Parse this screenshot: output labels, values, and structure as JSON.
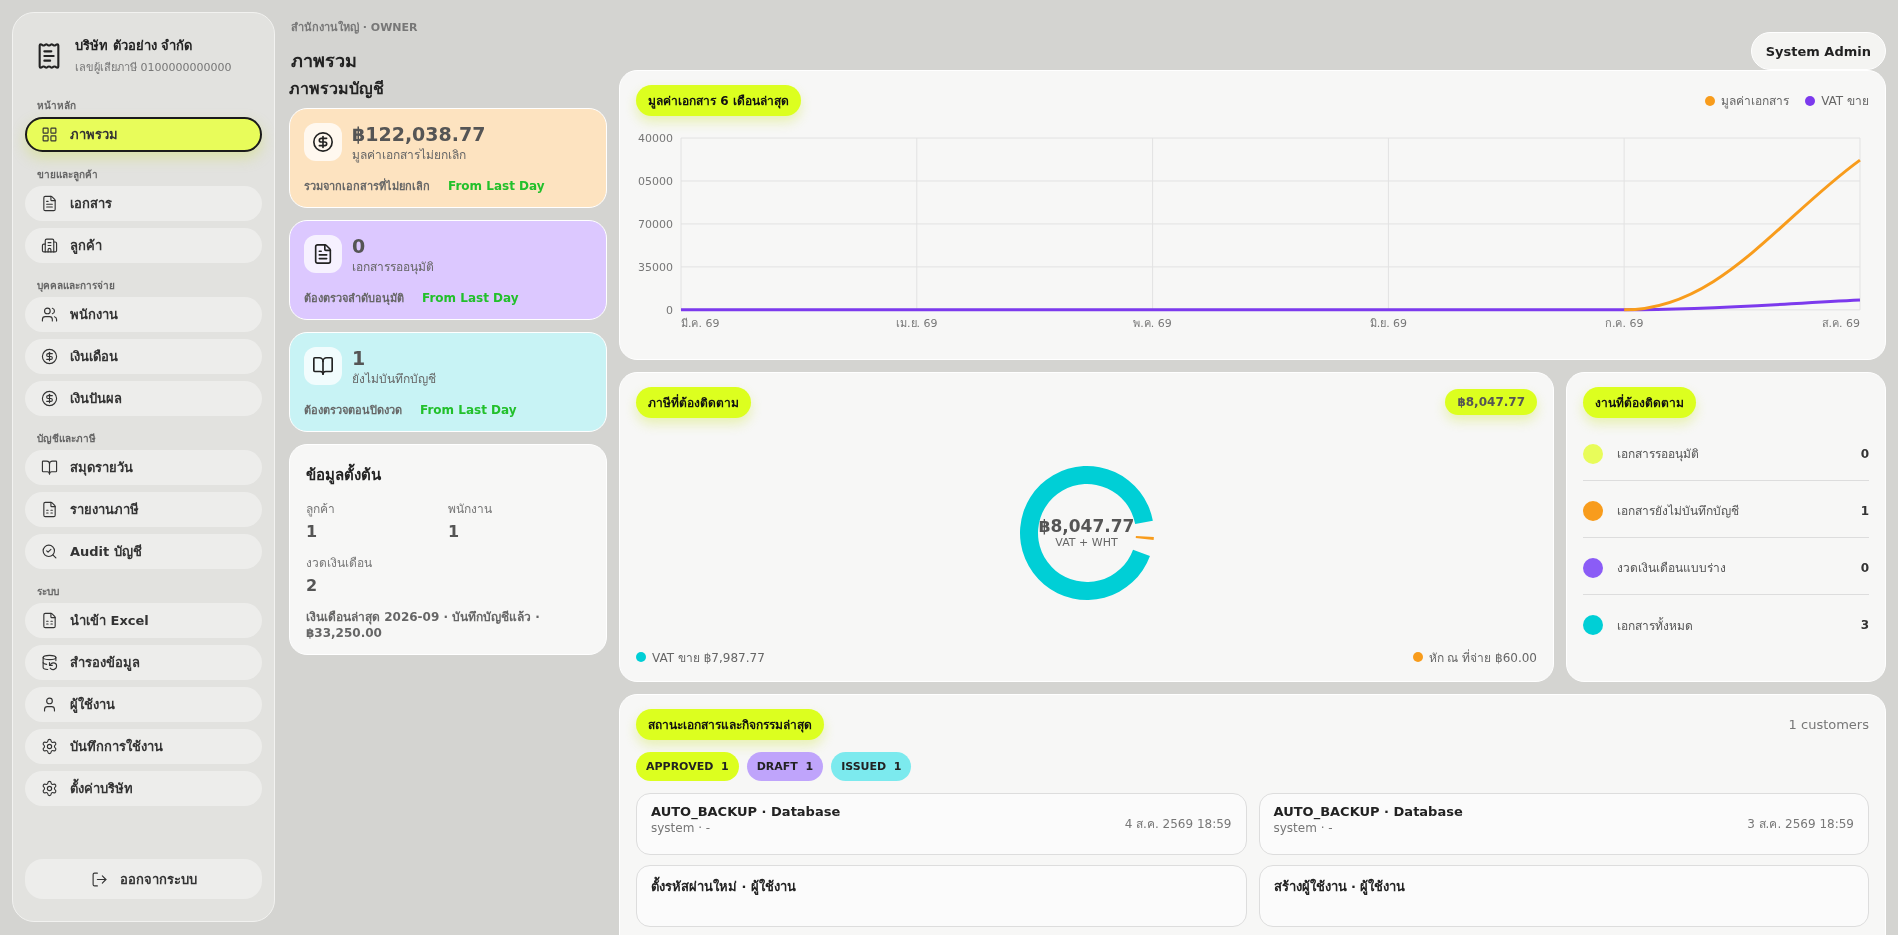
{
  "company": {
    "name": "บริษัท ตัวอย่าง จำกัด",
    "tax_id": "เลขผู้เสียภาษี 0100000000000"
  },
  "sidebar": {
    "sections": [
      {
        "title": "หน้าหลัก",
        "items": [
          {
            "label": "ภาพรวม",
            "selected": true
          }
        ]
      },
      {
        "title": "ขายและลูกค้า",
        "items": [
          {
            "label": "เอกสาร",
            "selected": false
          },
          {
            "label": "ลูกค้า",
            "selected": false
          }
        ]
      },
      {
        "title": "บุคคลและการจ่าย",
        "items": [
          {
            "label": "พนักงาน",
            "selected": false
          },
          {
            "label": "เงินเดือน",
            "selected": false
          },
          {
            "label": "เงินปันผล",
            "selected": false
          }
        ]
      },
      {
        "title": "บัญชีและภาษี",
        "items": [
          {
            "label": "สมุดรายวัน",
            "selected": false
          },
          {
            "label": "รายงานภาษี",
            "selected": false
          },
          {
            "label": "Audit บัญชี",
            "selected": false
          }
        ]
      },
      {
        "title": "ระบบ",
        "items": [
          {
            "label": "นำเข้า Excel",
            "selected": false
          },
          {
            "label": "สำรองข้อมูล",
            "selected": false
          },
          {
            "label": "ผู้ใช้งาน",
            "selected": false
          },
          {
            "label": "บันทึกการใช้งาน",
            "selected": false
          },
          {
            "label": "ตั้งค่าบริษัท",
            "selected": false
          }
        ]
      }
    ],
    "logout": "ออกจากระบบ"
  },
  "header": {
    "breadcrumb": "สำนักงานใหญ่ · OWNER",
    "title": "ภาพรวม",
    "user_button": "System Admin"
  },
  "overview": {
    "title": "ภาพรวมบัญชี",
    "cards": [
      {
        "value": "฿122,038.77",
        "label": "มูลค่าเอกสารไม่ยกเลิก",
        "note": "รวมจากเอกสารที่ไม่ยกเลิก",
        "trend": "From Last Day",
        "color": "#fde3c0"
      },
      {
        "value": "0",
        "label": "เอกสารรออนุมัติ",
        "note": "ต้องตรวจลำดับอนุมัติ",
        "trend": "From Last Day",
        "color": "#dcc8ff"
      },
      {
        "value": "1",
        "label": "ยังไม่บันทึกบัญชี",
        "note": "ต้องตรวจตอนปิดงวด",
        "trend": "From Last Day",
        "color": "#c8f3f5"
      }
    ]
  },
  "setup": {
    "title": "ข้อมูลตั้งต้น",
    "fields": [
      {
        "label": "ลูกค้า",
        "value": "1"
      },
      {
        "label": "พนักงาน",
        "value": "1"
      },
      {
        "label": "งวดเงินเดือน",
        "value": "2"
      }
    ],
    "note": "เงินเดือนล่าสุด 2026-09 · บันทึกบัญชีแล้ว · ฿33,250.00"
  },
  "value_chart": {
    "title": "มูลค่าเอกสาร 6 เดือนล่าสุด",
    "chart_data": {
      "type": "line",
      "categories": [
        "มี.ค. 69",
        "เม.ย. 69",
        "พ.ค. 69",
        "มิ.ย. 69",
        "ก.ค. 69",
        "ส.ค. 69"
      ],
      "series": [
        {
          "name": "มูลค่าเอกสาร",
          "color": "#f89c1c",
          "values": [
            null,
            null,
            null,
            null,
            0,
            122000
          ]
        },
        {
          "name": "VAT ขาย",
          "color": "#7c3aed",
          "values": [
            0,
            0,
            0,
            0,
            0,
            8000
          ]
        }
      ],
      "ylim": [
        0,
        140000
      ],
      "grid": true,
      "yticks": [
        0,
        35000,
        70000
      ]
    },
    "cut_y_labels": [
      "40000",
      "05000"
    ]
  },
  "tax": {
    "title": "ภาษีที่ต้องติดตาม",
    "total_badge": "฿8,047.77",
    "center_value": "฿8,047.77",
    "center_label": "VAT + WHT",
    "chart_data": {
      "type": "donut",
      "categories": [
        "VAT ขาย",
        "หัก ณ ที่จ่าย"
      ],
      "values": [
        99.25,
        0.75
      ]
    },
    "legend": [
      {
        "amount": "฿7,987.77",
        "color": "#00cfd6"
      },
      {
        "amount": "฿60.00",
        "color": "#f89c1c"
      }
    ]
  },
  "tasks": {
    "title": "งานที่ต้องติดตาม",
    "items": [
      {
        "label": "เอกสารรออนุมัติ",
        "count": "0",
        "color": "#e8fc5a"
      },
      {
        "label": "เอกสารยังไม่บันทึกบัญชี",
        "count": "1",
        "color": "#f89c1c"
      },
      {
        "label": "งวดเงินเดือนแบบร่าง",
        "count": "0",
        "color": "#8b5cf6"
      },
      {
        "label": "เอกสารทั้งหมด",
        "count": "3",
        "color": "#00cfd6"
      }
    ]
  },
  "activity": {
    "title": "สถานะเอกสารและกิจกรรมล่าสุด",
    "count": "1 customers",
    "statuses": [
      {
        "label": "APPROVED",
        "count": "1",
        "color": "#dcff1f"
      },
      {
        "label": "DRAFT",
        "count": "1",
        "color": "#bfa4fb"
      },
      {
        "label": "ISSUED",
        "count": "1",
        "color": "#7ceaee"
      }
    ],
    "items": [
      {
        "title": "AUTO_BACKUP · Database",
        "subtitle": "system · -",
        "time": "4 ส.ค. 2569 18:59"
      },
      {
        "title": "AUTO_BACKUP · Database",
        "subtitle": "system · -",
        "time": "3 ส.ค. 2569 18:59"
      },
      {
        "title": "ตั้งรหัสผ่านใหม่ · ผู้ใช้งาน"
      },
      {
        "title": "สร้างผู้ใช้งาน · ผู้ใช้งาน"
      }
    ]
  }
}
